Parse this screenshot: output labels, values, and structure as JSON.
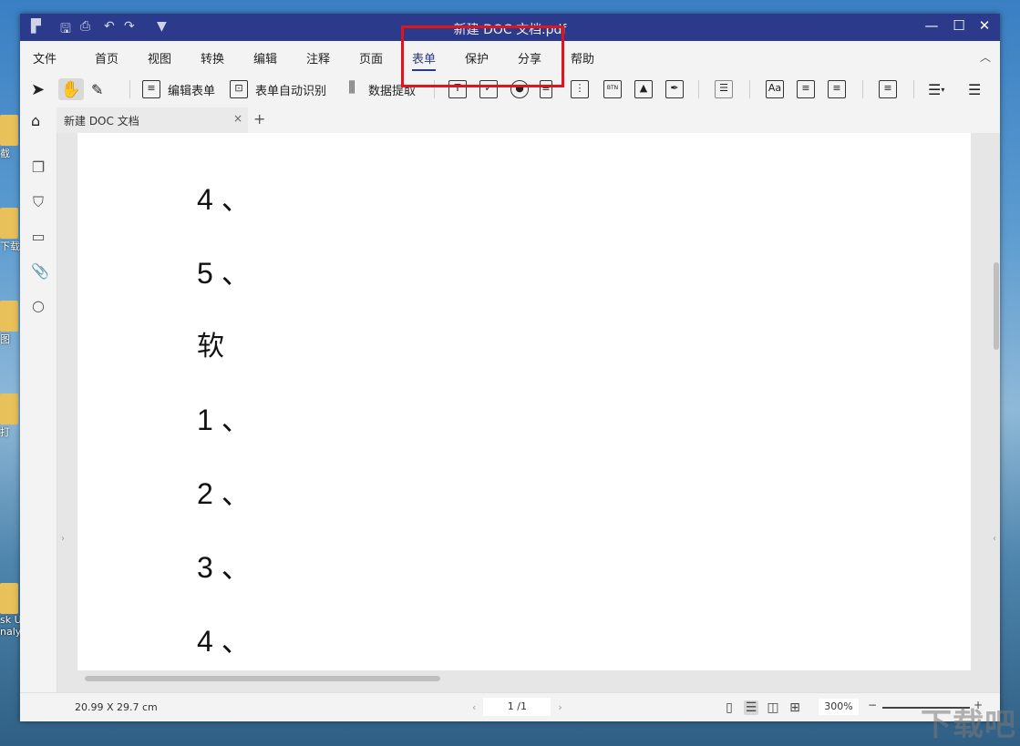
{
  "window": {
    "title": "新建 DOC 文档.pdf",
    "quick_icons": [
      "app-logo-icon",
      "save-icon",
      "print-icon",
      "undo-icon",
      "redo-icon",
      "customize-dropdown-icon"
    ],
    "controls": {
      "minimize": "—",
      "maximize": "☐",
      "close": "✕"
    }
  },
  "menu": {
    "items": [
      "文件",
      "首页",
      "视图",
      "转换",
      "编辑",
      "注释",
      "页面",
      "表单",
      "保护",
      "分享",
      "帮助"
    ],
    "active": "表单"
  },
  "toolbar": {
    "edit_form": "编辑表单",
    "auto_recognize": "表单自动识别",
    "data_extract": "数据提取"
  },
  "tab": {
    "label": "新建 DOC 文档",
    "close": "×",
    "new": "+"
  },
  "document": {
    "lines": [
      "4 、",
      "5 、",
      "软",
      "1 、",
      "2 、",
      "3 、",
      "4 、"
    ]
  },
  "status": {
    "dimensions": "20.99 X 29.7 cm",
    "page": "1 /1",
    "zoom": "300%",
    "zoom_out": "−",
    "zoom_in": "+"
  },
  "desktop": {
    "labels": [
      "截",
      "下载",
      "图",
      "打",
      "sk U",
      "naly"
    ]
  },
  "watermark": "下载吧",
  "colors": {
    "titlebar": "#2b3a8b",
    "highlight": "#e0141c",
    "accent": "#2b3a8b"
  }
}
